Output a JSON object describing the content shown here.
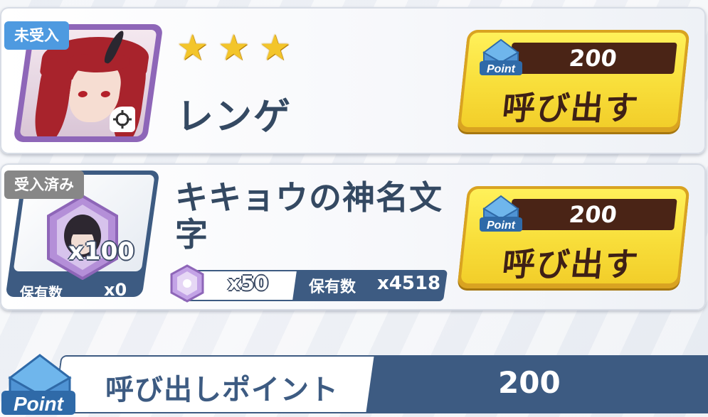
{
  "entries": [
    {
      "status_badge": "未受入",
      "rarity_stars": 3,
      "name": "レンゲ",
      "call_button": {
        "cost": "200",
        "label": "呼び出す",
        "currency_icon_text": "Point"
      }
    },
    {
      "status_badge": "受入済み",
      "name": "キキョウの神名文字",
      "reward_quantity": "x100",
      "owned_label": "保有数",
      "owned_value": "x0",
      "required_item_quantity": "x50",
      "required_item_owned_label": "保有数",
      "required_item_owned_value": "x4518",
      "call_button": {
        "cost": "200",
        "label": "呼び出す",
        "currency_icon_text": "Point"
      }
    }
  ],
  "points_summary": {
    "label": "呼び出しポイント",
    "value": "200",
    "icon_text": "Point"
  },
  "colors": {
    "accent_navy": "#3d5b82",
    "button_yellow": "#f8de3a",
    "cost_bar_brown": "#4a2416",
    "badge_blue": "#4e9ae0",
    "badge_gray": "#878787",
    "portrait_purple": "#8e66b8"
  },
  "icons": {
    "currency": "envelope-point-icon",
    "star": "star-icon",
    "portrait_action": "target-icon",
    "material": "purple-gem-icon"
  }
}
